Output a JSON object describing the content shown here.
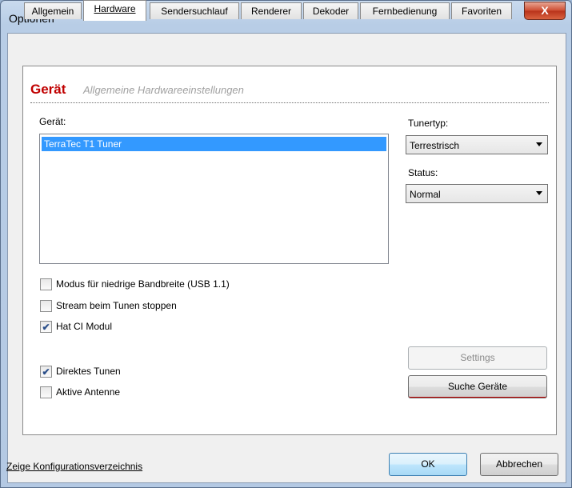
{
  "window": {
    "title": "Optionen",
    "close_glyph": "X"
  },
  "tabs": [
    {
      "label": "Allgemein"
    },
    {
      "label": "Hardware"
    },
    {
      "label": "Sendersuchlauf"
    },
    {
      "label": "Renderer"
    },
    {
      "label": "Dekoder"
    },
    {
      "label": "Fernbedienung"
    },
    {
      "label": "Favoriten"
    }
  ],
  "header": {
    "title": "Gerät",
    "subtitle": "Allgemeine Hardwareeinstellungen"
  },
  "device": {
    "label": "Gerät:",
    "items": [
      "TerraTec T1 Tuner"
    ],
    "selected_index": 0
  },
  "tunertype": {
    "label": "Tunertyp:",
    "value": "Terrestrisch"
  },
  "status": {
    "label": "Status:",
    "value": "Normal"
  },
  "checkboxes": {
    "low_bandwidth": {
      "label": "Modus für niedrige Bandbreite (USB 1.1)",
      "checked": false
    },
    "stop_stream": {
      "label": "Stream beim Tunen stoppen",
      "checked": false
    },
    "ci_module": {
      "label": "Hat CI Modul",
      "checked": true
    },
    "direct_tune": {
      "label": "Direktes Tunen",
      "checked": true
    },
    "active_antenna": {
      "label": "Aktive Antenne",
      "checked": false
    }
  },
  "buttons": {
    "settings": "Settings",
    "search_devices": "Suche Geräte",
    "ok": "OK",
    "cancel": "Abbrechen"
  },
  "footer": {
    "config_link": "Zeige Konfigurationsverzeichnis"
  },
  "icons": {
    "checkmark": "check-icon",
    "dropdown": "chevron-down-icon",
    "close": "close-icon"
  }
}
